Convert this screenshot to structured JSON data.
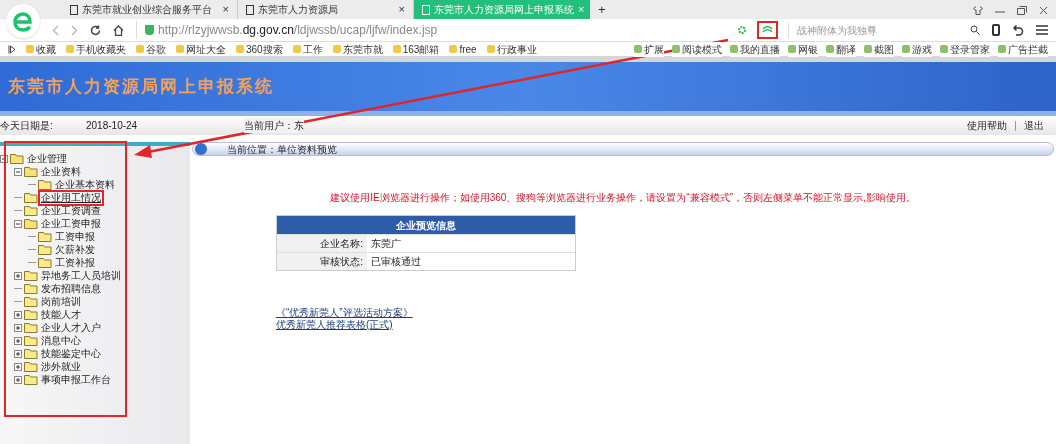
{
  "browser": {
    "tabs": [
      {
        "title": "东莞市就业创业综合服务平台",
        "selected": false
      },
      {
        "title": "东莞市人力资源局",
        "selected": false
      },
      {
        "title": "东莞市人力资源局网上申报系统",
        "selected": true
      }
    ],
    "tab_close": "×",
    "new_tab": "+",
    "url_prefix": "http://rlzyjwwsb.",
    "url_domain": "dg.gov.cn",
    "url_path": "/ldjwssb/ucap/ljfw/index.jsp",
    "search_placeholder": "战神附体为我独尊",
    "bookmarks": [
      "收藏",
      "手机收藏夹",
      "谷歌",
      "网址大全",
      "360搜索",
      "工作",
      "东莞市就",
      "163邮箱",
      "free",
      "行政事业"
    ],
    "tools": [
      "扩展",
      "阅读模式",
      "我的直播",
      "网银",
      "翻译",
      "截图",
      "游戏",
      "登录管家",
      "广告拦截"
    ]
  },
  "site": {
    "title": "东莞市人力资源局网上申报系统",
    "date_label": "今天日期是:",
    "date": "2018-10-24",
    "user_label": "当前用户：东",
    "help": "使用帮助",
    "logout": "退出",
    "breadcrumb": "当前位置：单位资料预览",
    "notice": "建议使用IE浏览器进行操作；如使用360、搜狗等浏览器进行业务操作，请设置为“兼容模式”，否则左侧菜单不能正常显示,影响使用。",
    "card": {
      "title": "企业预览信息",
      "rows": [
        {
          "label": "企业名称:",
          "value": "东莞广"
        },
        {
          "label": "审核状态:",
          "value": "已审核通过"
        }
      ]
    },
    "links": [
      "《“优秀新莞人”评选活动方案》",
      "优秀新莞人推荐表格(正式)"
    ]
  },
  "menu": [
    {
      "label": "企业管理",
      "expanded": true,
      "children": [
        {
          "label": "企业资料",
          "expanded": true,
          "children": [
            {
              "label": "企业基本资料"
            }
          ]
        },
        {
          "label": "企业用工情况",
          "highlighted": true
        },
        {
          "label": "企业工资调查"
        },
        {
          "label": "企业工资申报",
          "expanded": true,
          "children": [
            {
              "label": "工资申报"
            },
            {
              "label": "欠薪补发"
            },
            {
              "label": "工资补报"
            }
          ]
        },
        {
          "label": "异地务工人员培训",
          "expanded": false
        },
        {
          "label": "发布招聘信息"
        },
        {
          "label": "岗前培训"
        },
        {
          "label": "技能人才",
          "expanded": false
        },
        {
          "label": "企业人才入户",
          "expanded": false
        },
        {
          "label": "消息中心",
          "expanded": false
        },
        {
          "label": "技能鉴定中心",
          "expanded": false
        },
        {
          "label": "涉外就业",
          "expanded": false
        },
        {
          "label": "事项申报工作台",
          "expanded": false
        }
      ]
    }
  ]
}
